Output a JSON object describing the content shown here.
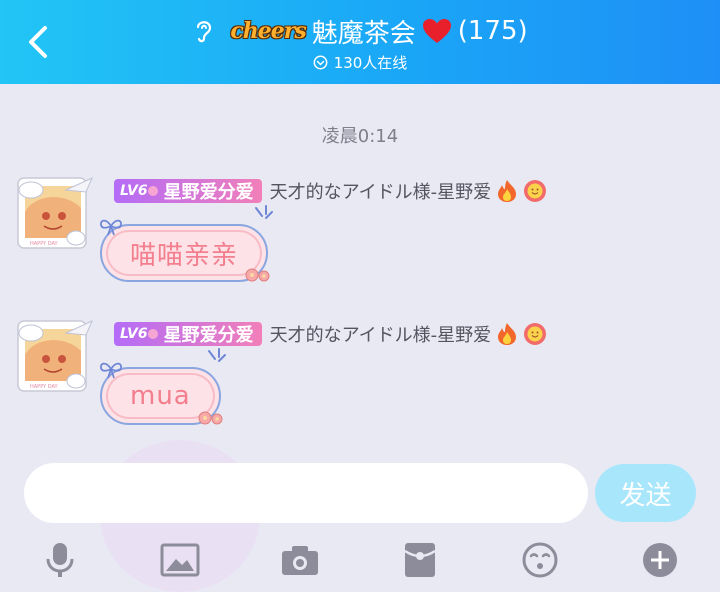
{
  "header": {
    "logo_text": "cheers",
    "title": "魅魔茶会",
    "member_count": "(175)",
    "online_text": "130人在线"
  },
  "chat": {
    "timestamp": "凌晨0:14",
    "messages": [
      {
        "level": "LV6",
        "badge_name": "星野爱分爱",
        "nickname": "天才的なアイドル様-星野爱",
        "text": "喵喵亲亲"
      },
      {
        "level": "LV6",
        "badge_name": "星野爱分爱",
        "nickname": "天才的なアイドル様-星野爱",
        "text": "mua"
      }
    ]
  },
  "composer": {
    "input_value": "",
    "send_label": "发送"
  },
  "colors": {
    "header_start": "#22c5f5",
    "header_end": "#1e8ff6",
    "send_button": "#a8e6fb",
    "bubble_text": "#f27e8e",
    "toolbar_icon": "#8c8c9a"
  },
  "icons": {
    "back": "chevron-left-icon",
    "listen": "ear-icon",
    "heart": "heart-icon",
    "online": "online-circle-icon",
    "toolbar": [
      "microphone-icon",
      "image-icon",
      "camera-icon",
      "red-packet-icon",
      "emoji-icon",
      "plus-icon"
    ]
  }
}
